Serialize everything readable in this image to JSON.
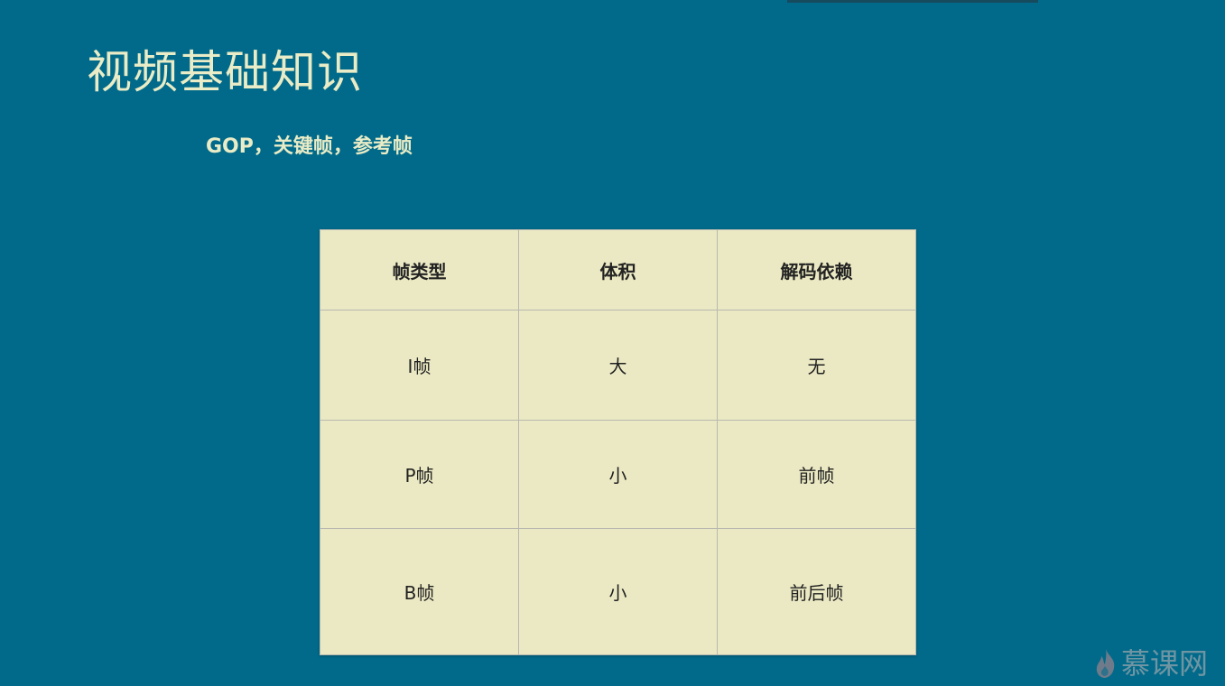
{
  "slide": {
    "title": "视频基础知识",
    "subtitle": "GOP，关键帧，参考帧"
  },
  "table": {
    "headers": [
      "帧类型",
      "体积",
      "解码依赖"
    ],
    "rows": [
      [
        "I帧",
        "大",
        "无"
      ],
      [
        "P帧",
        "小",
        "前帧"
      ],
      [
        "B帧",
        "小",
        "前后帧"
      ]
    ]
  },
  "watermark": {
    "text": "慕课网",
    "icon": "flame-logo-icon"
  },
  "colors": {
    "background": "#016a8a",
    "title_text": "#e9ecc6",
    "table_fill": "#ebe9c3",
    "table_text": "#222222"
  }
}
